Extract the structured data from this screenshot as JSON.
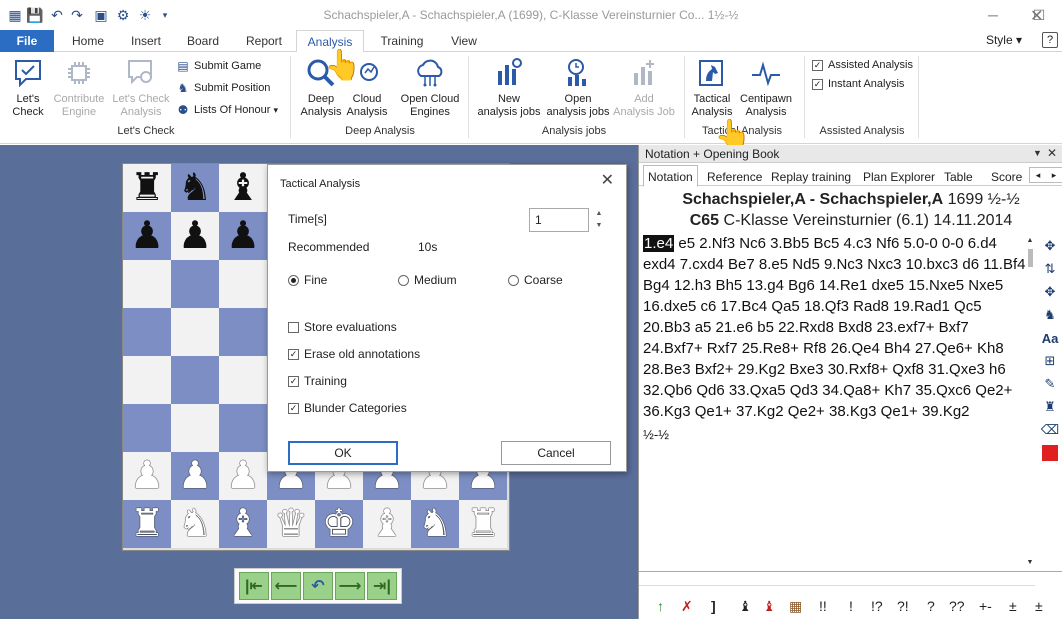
{
  "window": {
    "title": "Schachspieler,A - Schachspieler,A (1699), C-Klasse Vereinsturnier Co... 1½-½",
    "controls": [
      "minimize",
      "maximize",
      "close"
    ]
  },
  "quick_access_icons": [
    "database-icon",
    "save-icon",
    "undo-icon",
    "redo-icon",
    "board-icon",
    "gear-icon",
    "bulb-icon",
    "dropdown-icon"
  ],
  "ribbon": {
    "file_label": "File",
    "tabs": [
      "Home",
      "Insert",
      "Board",
      "Report",
      "Analysis",
      "Training",
      "View"
    ],
    "active_tab": "Analysis",
    "style_label": "Style",
    "help_label": "?",
    "lets_check": {
      "lets_check": "Let's\nCheck",
      "contribute_engine": "Contribute\nEngine",
      "lets_check_analysis": "Let's Check\nAnalysis",
      "submit_game": "Submit Game",
      "submit_position": "Submit Position",
      "lists_of_honour": "Lists Of Honour",
      "group": "Let's Check"
    },
    "deep_analysis": {
      "deep": "Deep\nAnalysis",
      "cloud": "Cloud\nAnalysis",
      "open_cloud": "Open Cloud\nEngines",
      "group": "Deep Analysis"
    },
    "analysis_jobs": {
      "new_job": "New\nanalysis jobs",
      "open_job": "Open\nanalysis jobs",
      "add_job": "Add\nAnalysis Job",
      "group": "Analysis jobs"
    },
    "tactical": {
      "tactical": "Tactical\nAnalysis",
      "centipawn": "Centipawn\nAnalysis",
      "group": "Tactical Analysis"
    },
    "assisted": {
      "assisted_analysis": "Assisted Analysis",
      "instant_analysis": "Instant Analysis",
      "group": "Assisted Analysis",
      "assisted_checked": true,
      "instant_checked": true
    }
  },
  "dialog": {
    "title": "Tactical Analysis",
    "close": "✕",
    "time_label": "Time[s]",
    "time_value": "1",
    "recommended_label": "Recommended",
    "recommended_value": "10s",
    "radios": [
      "Fine",
      "Medium",
      "Coarse"
    ],
    "selected_radio": "Fine",
    "checks": [
      {
        "label": "Store evaluations",
        "checked": false
      },
      {
        "label": "Erase old annotations",
        "checked": true
      },
      {
        "label": "Training",
        "checked": true
      },
      {
        "label": "Blunder Categories",
        "checked": true
      }
    ],
    "ok": "OK",
    "cancel": "Cancel"
  },
  "panel": {
    "title": "Notation + Opening Book",
    "tabs": [
      "Notation",
      "Reference",
      "Replay training",
      "Plan Explorer",
      "Table",
      "Score"
    ],
    "active_tab": "Notation",
    "header_line1_bold": "Schachspieler,A - Schachspieler,A",
    "header_line1_rest": "1699  ½-½",
    "header_line2_bold": "C65",
    "header_line2_rest": "C-Klasse Vereinsturnier (6.1) 14.11.2014",
    "current_move": "1.e4",
    "moves_text": " e5 2.Nf3 Nc6 3.Bb5 Bc5 4.c3 Nf6 5.0-0 0-0 6.d4 exd4 7.cxd4 Be7 8.e5 Nd5 9.Nc3 Nxc3 10.bxc3 d6 11.Bf4 Bg4 12.h3 Bh5 13.g4 Bg6 14.Re1 dxe5 15.Nxe5 Nxe5 16.dxe5 c6 17.Bc4 Qa5 18.Qf3 Rad8 19.Rad1 Qc5 20.Bb3 a5 21.e6 b5 22.Rxd8 Bxd8 23.exf7+ Bxf7 24.Bxf7+ Rxf7 25.Re8+ Rf8 26.Qe4 Bh4 27.Qe6+ Kh8 28.Be3 Bxf2+ 29.Kg2 Bxe3 30.Rxf8+ Qxf8 31.Qxe3 h6 32.Qb6 Qd6 33.Qxa5 Qd3 34.Qa8+ Kh7 35.Qxc6 Qe2+ 36.Kg3 Qe1+ 37.Kg2 Qe2+ 38.Kg3 Qe1+ 39.Kg2",
    "result": "½-½",
    "annotation_symbols": [
      "!!",
      "!",
      "!?",
      "?!",
      "?",
      "??",
      "+-",
      "±",
      "±"
    ]
  },
  "board": {
    "rows": [
      [
        "bR",
        "bN",
        "bB",
        "",
        "",
        "",
        "",
        ""
      ],
      [
        "bP",
        "bP",
        "bP",
        "",
        "",
        "",
        "",
        ""
      ],
      [
        "",
        "",
        "",
        "",
        "",
        "",
        "",
        ""
      ],
      [
        "",
        "",
        "",
        "",
        "",
        "",
        "",
        ""
      ],
      [
        "",
        "",
        "",
        "",
        "",
        "",
        "",
        ""
      ],
      [
        "",
        "",
        "",
        "",
        "",
        "",
        "",
        ""
      ],
      [
        "wP",
        "wP",
        "wP",
        "wP",
        "wP",
        "wP",
        "wP",
        "wP"
      ],
      [
        "wR",
        "wN",
        "wB",
        "wQ",
        "wK",
        "wB",
        "wN",
        "wR"
      ]
    ]
  },
  "navigation": [
    "first-move-icon",
    "prev-move-icon",
    "undo-move-icon",
    "next-move-icon",
    "last-move-icon"
  ]
}
